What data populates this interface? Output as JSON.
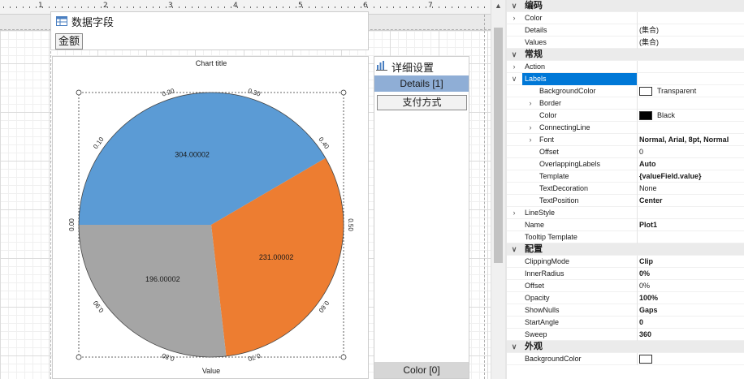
{
  "ruler": {
    "numbers": [
      "1",
      "2",
      "3",
      "4",
      "5",
      "6",
      "7"
    ]
  },
  "datafield": {
    "title": "数据字段",
    "chip": "金额"
  },
  "chart": {
    "title": "Chart title",
    "bottom_label": "Value",
    "axis_labels": [
      "0.00",
      "0.10",
      "0.20",
      "0.30",
      "0.40",
      "0.50",
      "0.60",
      "0.70",
      "0.80",
      "0.90"
    ]
  },
  "chart_data": {
    "type": "pie",
    "title": "Chart title",
    "xlabel": "Value",
    "categories": [
      "",
      "",
      ""
    ],
    "values": [
      304.00002,
      231.00002,
      196.00002
    ],
    "value_labels": [
      "304.00002",
      "231.00002",
      "196.00002"
    ],
    "colors": [
      "#5b9bd5",
      "#ed7d31",
      "#a5a5a5"
    ],
    "start_angle": 0,
    "sweep": 360
  },
  "details": {
    "title": "详细设置",
    "tab": "Details [1]",
    "item": "支付方式",
    "color_tab": "Color [0]"
  },
  "props": {
    "rows": [
      {
        "type": "cat",
        "label": "编码",
        "expander": "∨"
      },
      {
        "type": "prop",
        "label": "Color",
        "expander": "›",
        "value": ""
      },
      {
        "type": "prop",
        "label": "Details",
        "value": "(集合)"
      },
      {
        "type": "prop",
        "label": "Values",
        "value": "(集合)"
      },
      {
        "type": "cat",
        "label": "常规",
        "expander": "∨"
      },
      {
        "type": "prop",
        "label": "Action",
        "expander": "›",
        "value": ""
      },
      {
        "type": "prop",
        "label": "Labels",
        "expander": "∨",
        "value": "",
        "selected": true
      },
      {
        "type": "sub",
        "label": "BackgroundColor",
        "value": "Transparent",
        "swatch": "#ffffff"
      },
      {
        "type": "sub",
        "label": "Border",
        "expander": "›",
        "value": ""
      },
      {
        "type": "sub",
        "label": "Color",
        "value": "Black",
        "swatch": "#000000"
      },
      {
        "type": "sub",
        "label": "ConnectingLine",
        "expander": "›",
        "value": ""
      },
      {
        "type": "sub",
        "label": "Font",
        "expander": "›",
        "value": "Normal, Arial, 8pt, Normal",
        "bold": true
      },
      {
        "type": "sub",
        "label": "Offset",
        "value": "0"
      },
      {
        "type": "sub",
        "label": "OverlappingLabels",
        "value": "Auto",
        "bold": true
      },
      {
        "type": "sub",
        "label": "Template",
        "value": "{valueField.value}",
        "bold": true
      },
      {
        "type": "sub",
        "label": "TextDecoration",
        "value": "None"
      },
      {
        "type": "sub",
        "label": "TextPosition",
        "value": "Center",
        "bold": true
      },
      {
        "type": "prop",
        "label": "LineStyle",
        "expander": "›",
        "value": ""
      },
      {
        "type": "prop",
        "label": "Name",
        "value": "Plot1",
        "bold": true
      },
      {
        "type": "prop",
        "label": "Tooltip Template",
        "value": ""
      },
      {
        "type": "cat",
        "label": "配置",
        "expander": "∨"
      },
      {
        "type": "prop",
        "label": "ClippingMode",
        "value": "Clip",
        "bold": true
      },
      {
        "type": "prop",
        "label": "InnerRadius",
        "value": "0%",
        "bold": true
      },
      {
        "type": "prop",
        "label": "Offset",
        "value": "0%"
      },
      {
        "type": "prop",
        "label": "Opacity",
        "value": "100%",
        "bold": true
      },
      {
        "type": "prop",
        "label": "ShowNulls",
        "value": "Gaps",
        "bold": true
      },
      {
        "type": "prop",
        "label": "StartAngle",
        "value": "0",
        "bold": true
      },
      {
        "type": "prop",
        "label": "Sweep",
        "value": "360",
        "bold": true
      },
      {
        "type": "cat",
        "label": "外观",
        "expander": "∨"
      },
      {
        "type": "prop",
        "label": "BackgroundColor",
        "value": "",
        "swatch": "#ffffff"
      }
    ]
  }
}
